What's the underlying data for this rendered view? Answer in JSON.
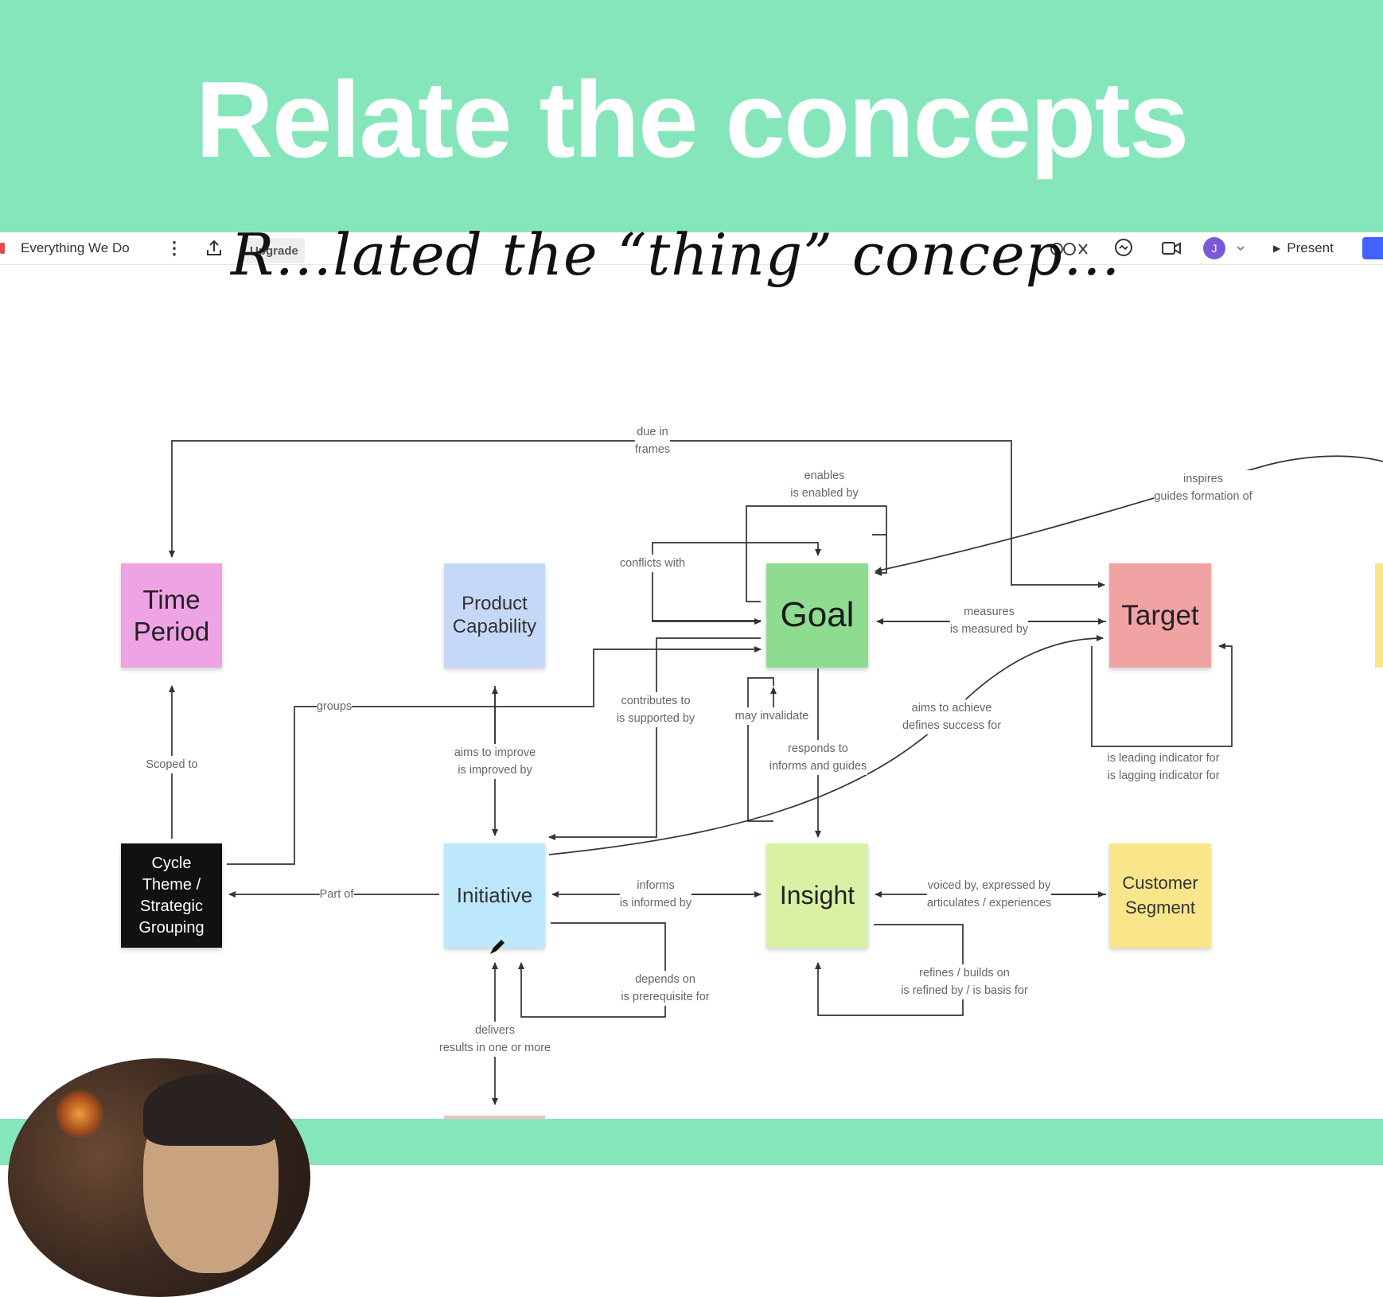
{
  "banner": {
    "title": "Relate the concepts"
  },
  "toolbar": {
    "board_name": "Everything We Do",
    "upgrade_label": "Upgrade",
    "present_label": "Present",
    "avatar_initial": "J",
    "icons": [
      "menu-dots-icon",
      "share-icon",
      "reactions-icon",
      "comment-icon",
      "video-icon",
      "chevron-down-icon",
      "play-icon"
    ]
  },
  "heading": "R…lated the “thing” concep…",
  "nodes": {
    "time_period": "Time Period",
    "product_capability": "Product Capability",
    "goal": "Goal",
    "target": "Target",
    "cycle": "Cycle Theme / Strategic Grouping",
    "initiative": "Initiative",
    "insight": "Insight",
    "customer_segment": "Customer Segment"
  },
  "colors": {
    "banner": "#86e6bb",
    "time_period": "#eea3e4",
    "product_capability": "#c6d8f7",
    "goal": "#8edc8f",
    "target": "#f1a3a3",
    "cycle": "#111111",
    "initiative": "#bde7fa",
    "insight": "#daf1a5",
    "customer_segment": "#f9e68a",
    "connector": "#333333"
  },
  "edge_labels": {
    "due_in": {
      "l1": "due in",
      "l2": "frames"
    },
    "enables": {
      "l1": "enables",
      "l2": "is enabled by"
    },
    "inspires": {
      "l1": "inspires",
      "l2": "guides formation of"
    },
    "conflicts": {
      "l1": "conflicts with"
    },
    "measures": {
      "l1": "measures",
      "l2": "is measured by"
    },
    "groups": {
      "l1": "groups"
    },
    "contributes": {
      "l1": "contributes to",
      "l2": "is supported by"
    },
    "may_invalidate": {
      "l1": "may invalidate"
    },
    "aims_achieve": {
      "l1": "aims to achieve",
      "l2": "defines success for"
    },
    "scoped": {
      "l1": "Scoped to"
    },
    "aims_improve": {
      "l1": "aims to improve",
      "l2": "is improved by"
    },
    "responds": {
      "l1": "responds to",
      "l2": "informs and guides"
    },
    "leading": {
      "l1": "is leading indicator for",
      "l2": "is lagging indicator for"
    },
    "part_of": {
      "l1": "Part of"
    },
    "informs": {
      "l1": "informs",
      "l2": "is informed by"
    },
    "voiced": {
      "l1": "voiced by, expressed by",
      "l2": "articulates / experiences"
    },
    "depends": {
      "l1": "depends on",
      "l2": "is prerequisite for"
    },
    "refines": {
      "l1": "refines / builds on",
      "l2": "is refined by / is basis for"
    },
    "delivers": {
      "l1": "delivers",
      "l2": "results in one or more"
    }
  }
}
